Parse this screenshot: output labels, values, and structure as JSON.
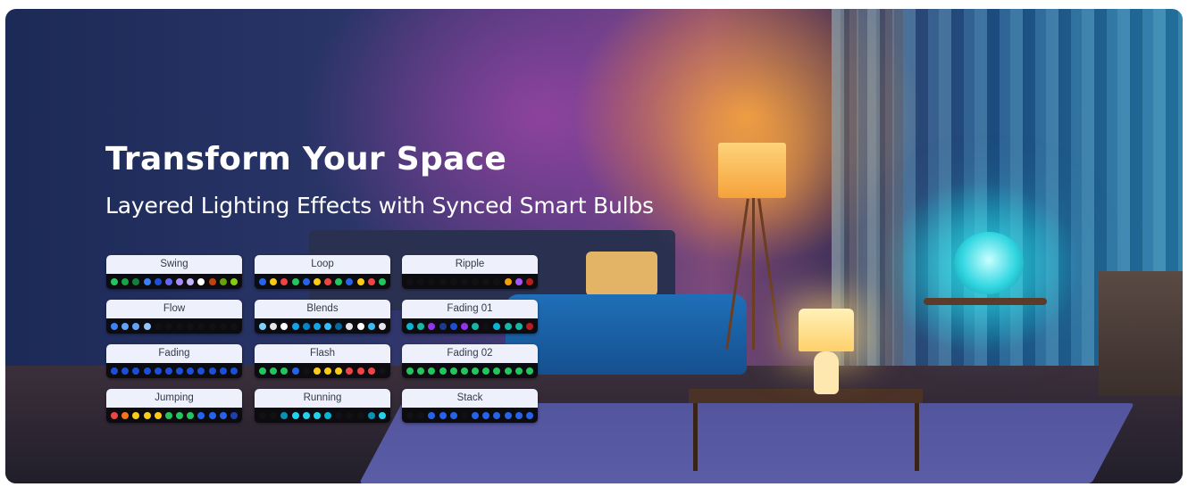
{
  "banner": {
    "title": "Transform Your Space",
    "subtitle": "Layered Lighting Effects with Synced Smart Bulbs"
  },
  "effects": [
    {
      "label": "Swing",
      "dots": [
        "#22c55e",
        "#16a34a",
        "#15803d",
        "#3b82f6",
        "#1d4ed8",
        "#6366f1",
        "#a78bfa",
        "#c4b5fd",
        "#ffffff",
        "#c2410c",
        "#65a30d",
        "#84cc16"
      ]
    },
    {
      "label": "Loop",
      "dots": [
        "#2563eb",
        "#facc15",
        "#ef4444",
        "#22c55e",
        "#2563eb",
        "#facc15",
        "#ef4444",
        "#22c55e",
        "#2563eb",
        "#facc15",
        "#ef4444",
        "#22c55e"
      ]
    },
    {
      "label": "Ripple",
      "dots": [
        "#111114",
        "#111114",
        "#111114",
        "#111114",
        "#111114",
        "#111114",
        "#111114",
        "#111114",
        "#111114",
        "#f59e0b",
        "#a855f7",
        "#b91c1c"
      ]
    },
    {
      "label": "Flow",
      "dots": [
        "#3b82f6",
        "#60a5fa",
        "#60a5fa",
        "#93c5fd",
        "#111114",
        "#111114",
        "#111114",
        "#111114",
        "#111114",
        "#111114",
        "#111114",
        "#111114"
      ]
    },
    {
      "label": "Blends",
      "dots": [
        "#7dd3fc",
        "#e5e7eb",
        "#ffffff",
        "#0ea5e9",
        "#0284c7",
        "#0ea5e9",
        "#38bdf8",
        "#0369a1",
        "#e5e7eb",
        "#ffffff",
        "#38bdf8",
        "#e5e7eb"
      ]
    },
    {
      "label": "Fading 01",
      "dots": [
        "#06b6d4",
        "#14b8a6",
        "#9333ea",
        "#1e3a8a",
        "#1d4ed8",
        "#9333ea",
        "#14b8a6",
        "#111114",
        "#06b6d4",
        "#14b8a6",
        "#14b8a6",
        "#b91c1c"
      ]
    },
    {
      "label": "Fading",
      "dots": [
        "#1d4ed8",
        "#1d4ed8",
        "#1d4ed8",
        "#1d4ed8",
        "#1d4ed8",
        "#1d4ed8",
        "#1d4ed8",
        "#1d4ed8",
        "#1d4ed8",
        "#1d4ed8",
        "#1d4ed8",
        "#1d4ed8"
      ]
    },
    {
      "label": "Flash",
      "dots": [
        "#22c55e",
        "#22c55e",
        "#22c55e",
        "#2563eb",
        "#111114",
        "#facc15",
        "#facc15",
        "#facc15",
        "#ef4444",
        "#ef4444",
        "#ef4444",
        "#111114"
      ]
    },
    {
      "label": "Fading 02",
      "dots": [
        "#22c55e",
        "#22c55e",
        "#22c55e",
        "#22c55e",
        "#22c55e",
        "#22c55e",
        "#22c55e",
        "#22c55e",
        "#22c55e",
        "#22c55e",
        "#22c55e",
        "#22c55e"
      ]
    },
    {
      "label": "Jumping",
      "dots": [
        "#ef4444",
        "#f97316",
        "#facc15",
        "#facc15",
        "#facc15",
        "#22c55e",
        "#22c55e",
        "#22c55e",
        "#2563eb",
        "#2563eb",
        "#2563eb",
        "#1e40af"
      ]
    },
    {
      "label": "Running",
      "dots": [
        "#111114",
        "#111114",
        "#0891b2",
        "#22d3ee",
        "#22d3ee",
        "#22d3ee",
        "#06b6d4",
        "#111114",
        "#111114",
        "#111114",
        "#0891b2",
        "#22d3ee"
      ]
    },
    {
      "label": "Stack",
      "dots": [
        "#111114",
        "#111114",
        "#2563eb",
        "#2563eb",
        "#2563eb",
        "#111114",
        "#2563eb",
        "#2563eb",
        "#2563eb",
        "#2563eb",
        "#2563eb",
        "#2563eb"
      ]
    }
  ]
}
